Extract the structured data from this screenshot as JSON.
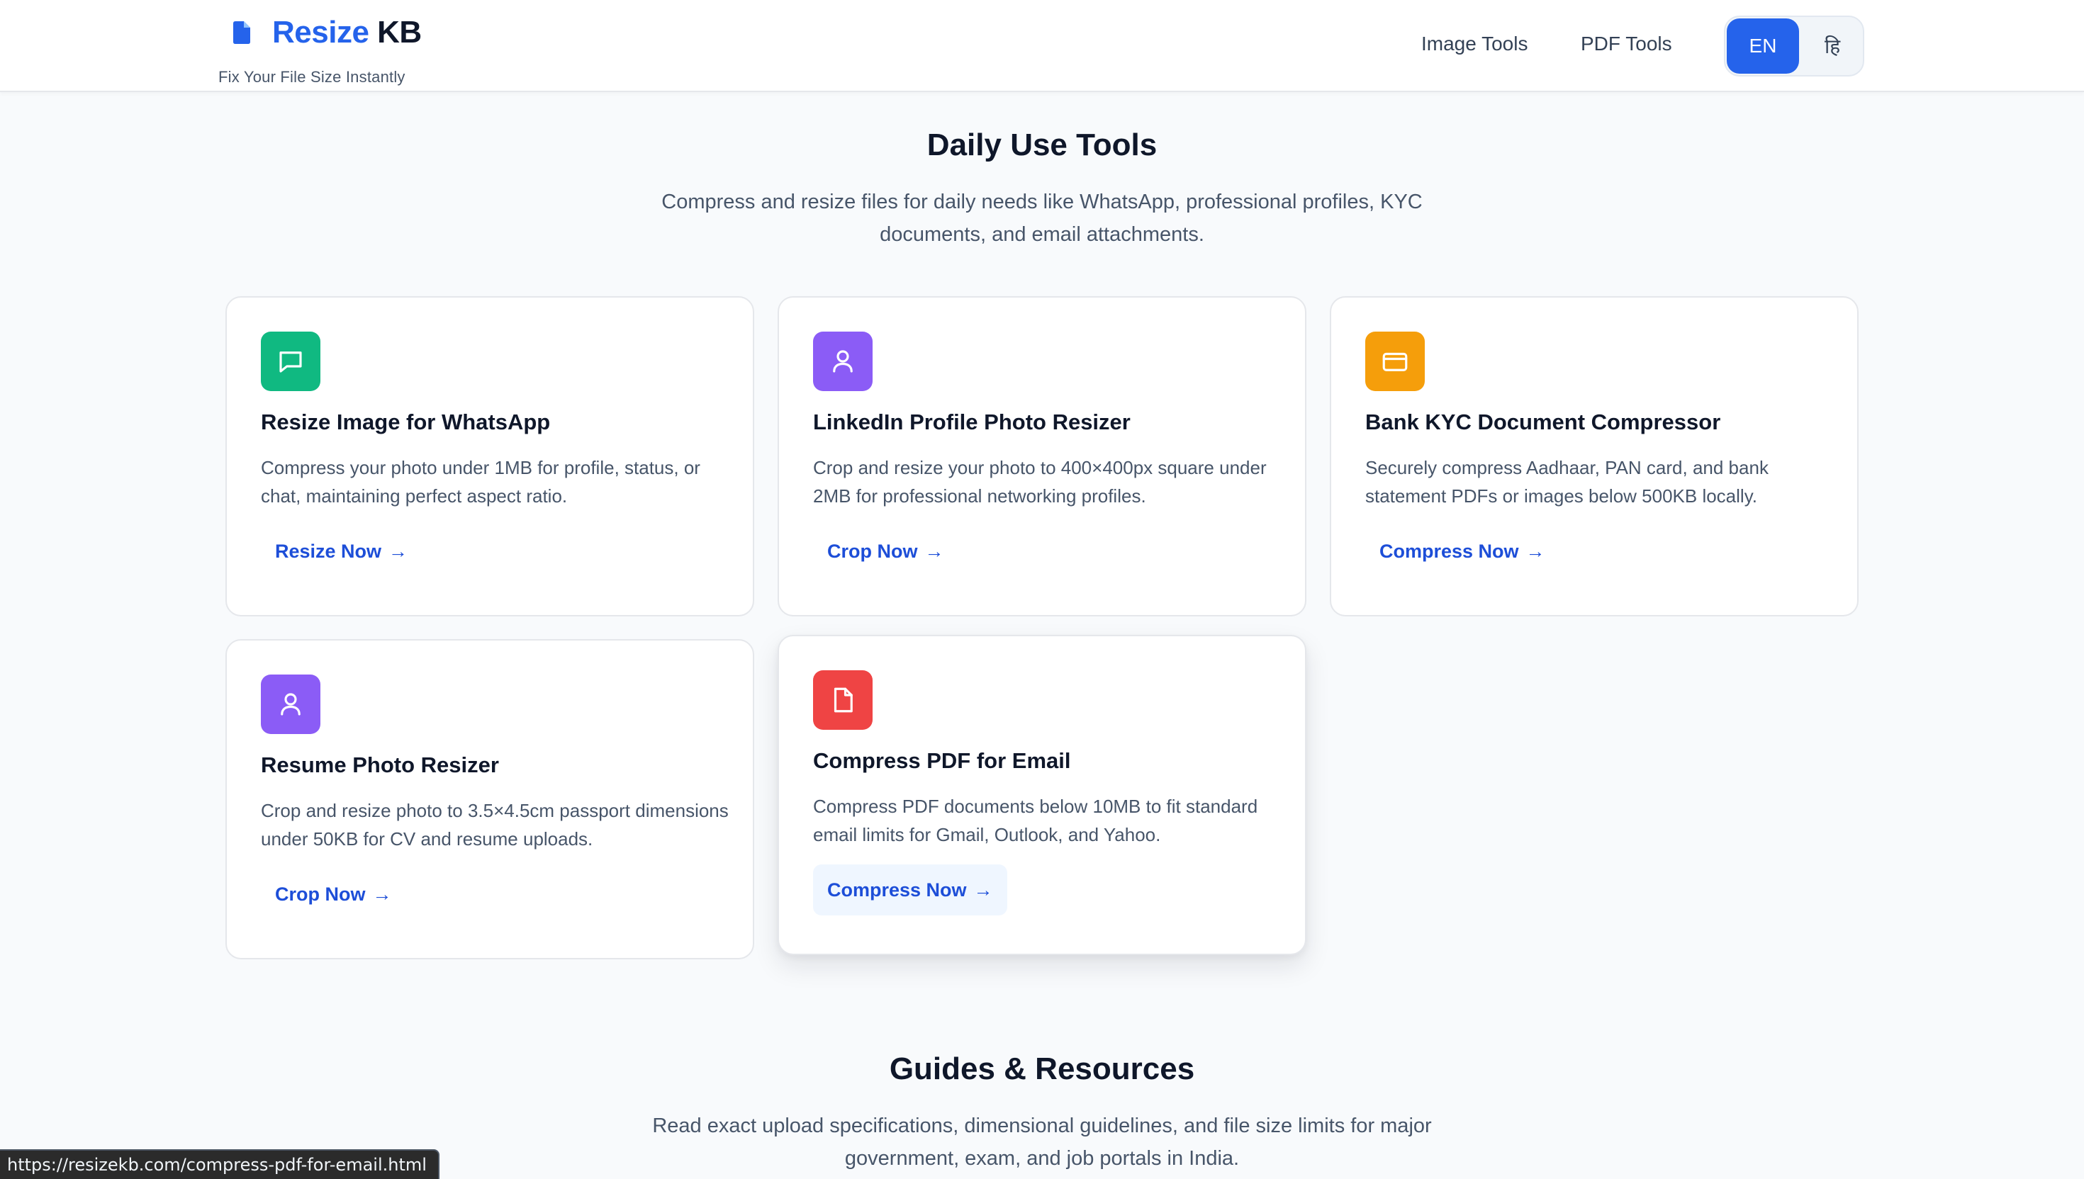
{
  "header": {
    "brand_accent": "Resize",
    "brand_rest": "KB",
    "tagline": "Fix Your File Size Instantly",
    "nav": [
      "Image Tools",
      "PDF Tools"
    ],
    "lang_active": "EN",
    "lang_alt": "हि"
  },
  "daily": {
    "title": "Daily Use Tools",
    "subtitle": "Compress and resize files for daily needs like WhatsApp, professional profiles, KYC documents, and email attachments.",
    "cards": [
      {
        "icon": "chat-icon",
        "icon_color": "#10b981",
        "title": "Resize Image for WhatsApp",
        "desc": "Compress your photo under 1MB for profile, status, or chat, maintaining perfect aspect ratio.",
        "link": "Resize Now"
      },
      {
        "icon": "user-icon",
        "icon_color": "#8b5cf6",
        "title": "LinkedIn Profile Photo Resizer",
        "desc": "Crop and resize your photo to 400×400px square under 2MB for professional networking profiles.",
        "link": "Crop Now"
      },
      {
        "icon": "credit-card-icon",
        "icon_color": "#f59e0b",
        "title": "Bank KYC Document Compressor",
        "desc": "Securely compress Aadhaar, PAN card, and bank statement PDFs or images below 500KB locally.",
        "link": "Compress Now"
      },
      {
        "icon": "user-icon",
        "icon_color": "#8b5cf6",
        "title": "Resume Photo Resizer",
        "desc": "Crop and resize photo to 3.5×4.5cm passport dimensions under 50KB for CV and resume uploads.",
        "link": "Crop Now"
      },
      {
        "icon": "file-icon",
        "icon_color": "#ef4444",
        "title": "Compress PDF for Email",
        "desc": "Compress PDF documents below 10MB to fit standard email limits for Gmail, Outlook, and Yahoo.",
        "link": "Compress Now"
      }
    ]
  },
  "guides": {
    "title": "Guides & Resources",
    "subtitle": "Read exact upload specifications, dimensional guidelines, and file size limits for major government, exam, and job portals in India."
  },
  "status_bar": {
    "url": "https://resizekb.com/compress-pdf-for-email.html"
  },
  "colors": {
    "accent": "#2563eb",
    "link": "#1d4ed8"
  }
}
